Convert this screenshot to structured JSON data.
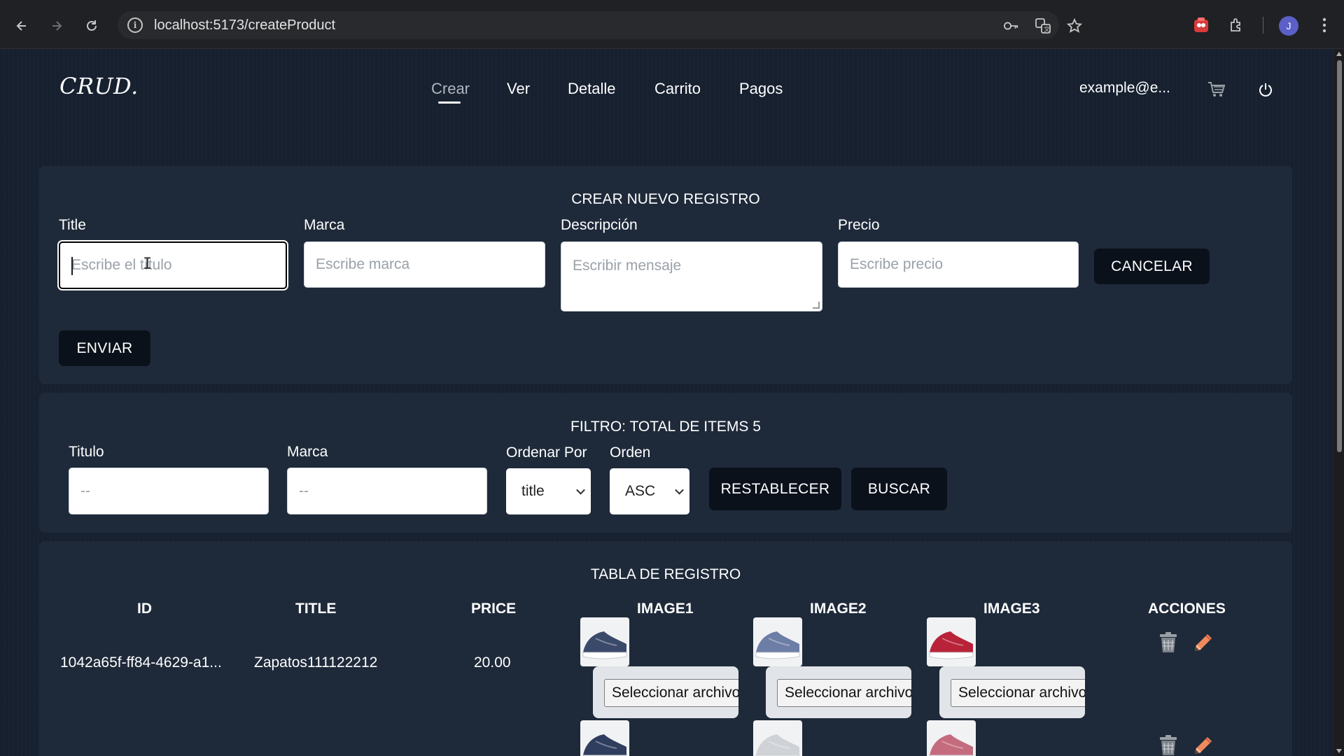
{
  "browser": {
    "url": "localhost:5173/createProduct",
    "profile_initial": "J"
  },
  "header": {
    "brand": "CRUD.",
    "nav": [
      {
        "label": "Crear",
        "active": true
      },
      {
        "label": "Ver"
      },
      {
        "label": "Detalle"
      },
      {
        "label": "Carrito"
      },
      {
        "label": "Pagos"
      }
    ],
    "user_email": "example@e...",
    "icons": [
      "cart-icon",
      "power-icon"
    ]
  },
  "create_form": {
    "title": "CREAR NUEVO REGISTRO",
    "fields": {
      "title": {
        "label": "Title",
        "placeholder": "Escribe el título",
        "value": ""
      },
      "marca": {
        "label": "Marca",
        "placeholder": "Escribe marca",
        "value": ""
      },
      "descripcion": {
        "label": "Descripción",
        "placeholder": "Escribir mensaje",
        "value": ""
      },
      "precio": {
        "label": "Precio",
        "placeholder": "Escribe precio",
        "value": ""
      }
    },
    "cancel_label": "CANCELAR",
    "submit_label": "ENVIAR"
  },
  "filter": {
    "title": "FILTRO: TOTAL DE ITEMS 5",
    "titulo": {
      "label": "Titulo",
      "placeholder": "--"
    },
    "marca": {
      "label": "Marca",
      "placeholder": "--"
    },
    "ordenar_por": {
      "label": "Ordenar Por",
      "selected": "title"
    },
    "orden": {
      "label": "Orden",
      "selected": "ASC"
    },
    "reset_label": "RESTABLECER",
    "search_label": "BUSCAR"
  },
  "table": {
    "title": "TABLA DE REGISTRO",
    "columns": [
      "ID",
      "TITLE",
      "PRICE",
      "IMAGE1",
      "IMAGE2",
      "IMAGE3",
      "ACCIONES"
    ],
    "file_button_label": "Seleccionar archivo",
    "rows": [
      {
        "id": "1042a65f-ff84-4629-a1...",
        "title": "Zapatos111122212",
        "price": "20.00",
        "images": [
          {
            "shoe_color": "#3b4a6b",
            "sole": "#ffffff",
            "bg": "#f1f2f4"
          },
          {
            "shoe_color": "#6d7ea6",
            "sole": "#ffffff",
            "bg": "#f1f2f4"
          },
          {
            "shoe_color": "#b8233a",
            "sole": "#ffffff",
            "bg": "#f1f2f4"
          }
        ]
      },
      {
        "id": "",
        "title": "",
        "price": "",
        "images": [
          {
            "shoe_color": "#2f3d5e",
            "sole": "#ffffff",
            "bg": "#f1f2f4"
          },
          {
            "shoe_color": "#cfd2d6",
            "sole": "#ffffff",
            "bg": "#f1f2f4"
          },
          {
            "shoe_color": "#c56b7e",
            "sole": "#ffffff",
            "bg": "#f1f2f4"
          }
        ]
      }
    ]
  },
  "colors": {
    "page_bg": "#16202f",
    "card_bg": "#1e2a3a",
    "button_bg": "#0b111b",
    "edit_icon": "#f08a5d",
    "trash_icon": "#9aa0a6"
  }
}
